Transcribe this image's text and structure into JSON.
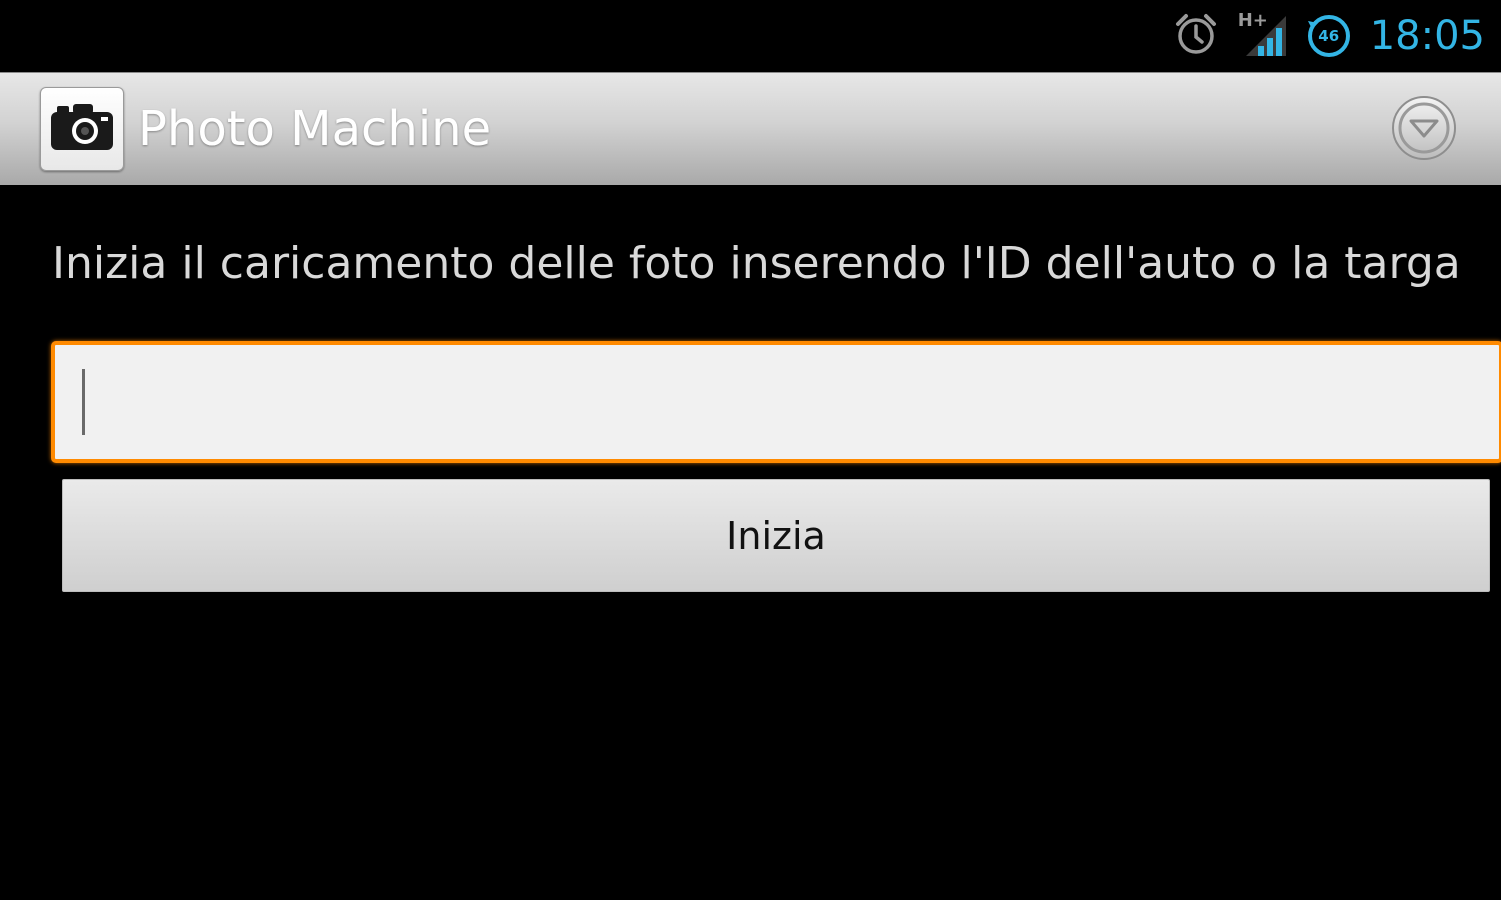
{
  "status_bar": {
    "time": "18:05",
    "icons": [
      "alarm-icon",
      "signal-icon",
      "sync-icon"
    ],
    "network_label": "H+",
    "badge_label": "46",
    "accent_color": "#33b5e5"
  },
  "action_bar": {
    "title": "Photo Machine",
    "app_icon": "camera-icon",
    "overflow_icon": "chevron-down-circle-icon"
  },
  "main": {
    "prompt": "Inizia il caricamento delle foto inserendo l'ID dell'auto o la targa",
    "input": {
      "value": "",
      "placeholder": "",
      "focus_color": "#ff8a00"
    },
    "start_button_label": "Inizia"
  }
}
